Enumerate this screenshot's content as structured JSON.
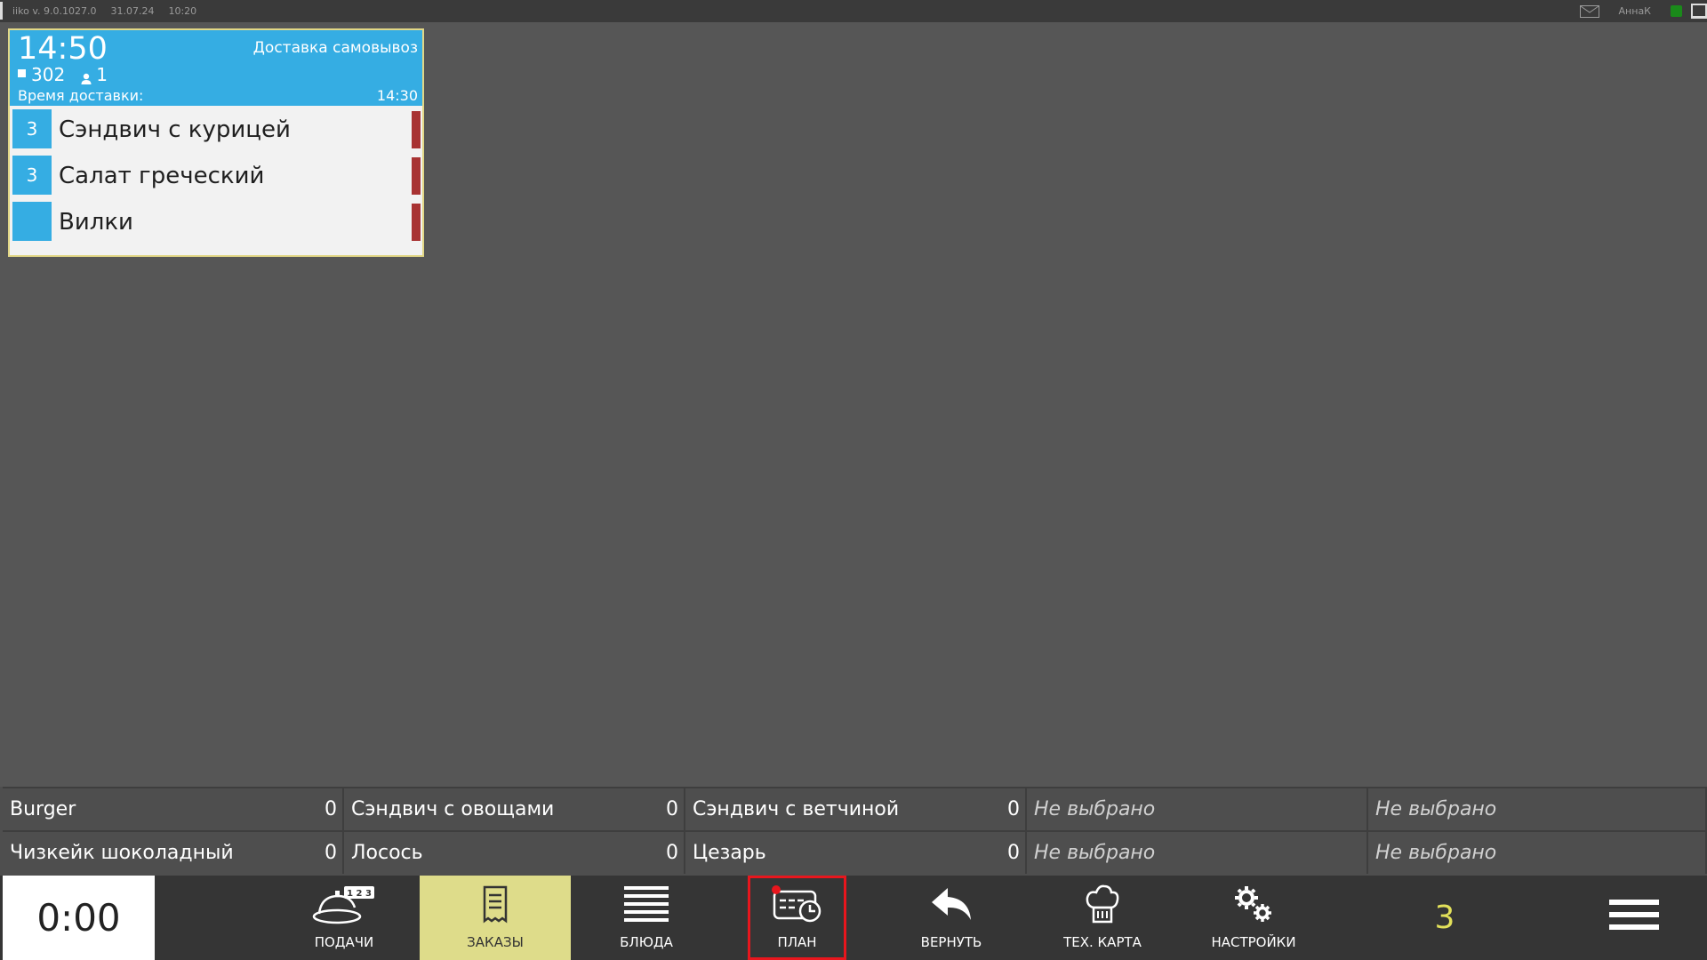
{
  "topbar": {
    "app": "iiko",
    "version": "v. 9.0.1027.0",
    "date": "31.07.24",
    "time": "10:20",
    "user": "АннаК"
  },
  "order": {
    "time": "14:50",
    "type": "Доставка самовывоз",
    "table": "302",
    "guests": "1",
    "delivery_label": "Время доставки:",
    "delivery_time": "14:30",
    "items": [
      {
        "qty": "3",
        "name": "Сэндвич с курицей"
      },
      {
        "qty": "3",
        "name": "Салат греческий"
      },
      {
        "qty": "",
        "name": "Вилки"
      }
    ]
  },
  "stoplist": {
    "row1": [
      {
        "name": "Burger",
        "count": "0"
      },
      {
        "name": "Сэндвич с овощами",
        "count": "0"
      },
      {
        "name": "Сэндвич с ветчиной",
        "count": "0"
      },
      {
        "name": "Не выбрано",
        "count": ""
      },
      {
        "name": "Не выбрано",
        "count": ""
      }
    ],
    "row2": [
      {
        "name": "Чизкейк шоколадный",
        "count": "0"
      },
      {
        "name": "Лосось",
        "count": "0"
      },
      {
        "name": "Цезарь",
        "count": "0"
      },
      {
        "name": "Не выбрано",
        "count": ""
      },
      {
        "name": "Не выбрано",
        "count": ""
      }
    ]
  },
  "toolbar": {
    "timer": "0:00",
    "buttons": [
      {
        "label": "ПОДАЧИ",
        "icon": "serving-dish-icon"
      },
      {
        "label": "ЗАКАЗЫ",
        "icon": "receipt-icon"
      },
      {
        "label": "БЛЮДА",
        "icon": "list-lines-icon"
      },
      {
        "label": "ПЛАН",
        "icon": "plan-schedule-icon"
      },
      {
        "label": "ВЕРНУТЬ",
        "icon": "undo-arrow-icon"
      },
      {
        "label": "ТЕХ. КАРТА",
        "icon": "chef-hat-icon"
      },
      {
        "label": "НАСТРОЙКИ",
        "icon": "gears-icon"
      }
    ],
    "count": "3"
  },
  "colors": {
    "accent_blue": "#35ade3",
    "active_tab": "#dedc8a",
    "highlight_red": "#e8161d",
    "flag_red": "#a83232",
    "count_yellow": "#e2e05a"
  }
}
